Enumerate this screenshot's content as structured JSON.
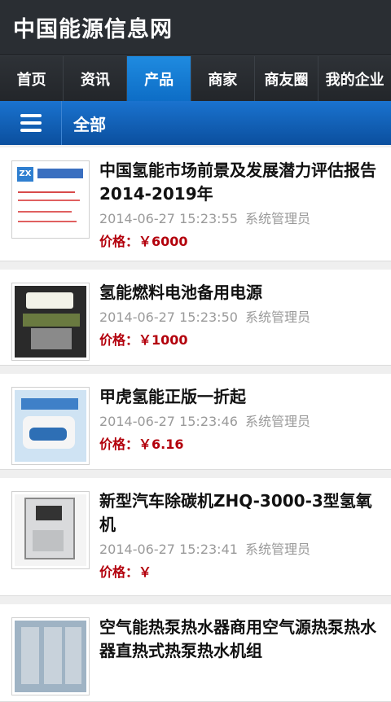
{
  "header": {
    "title": "中国能源信息网"
  },
  "nav": {
    "tabs": [
      "首页",
      "资讯",
      "产品",
      "商家",
      "商友圈",
      "我的企业"
    ],
    "active": 2
  },
  "subbar": {
    "title": "全部",
    "menu_icon": "hamburger-menu-icon"
  },
  "colors": {
    "accent": "#1577d6",
    "price": "#b3000c",
    "header_bg": "#2a2e33"
  },
  "products": [
    {
      "title": "中国氢能市场前景及发展潜力评估报告2014-2019年",
      "date": "2014-06-27 15:23:55",
      "author": "系统管理员",
      "price": "价格：￥6000"
    },
    {
      "title": "氢能燃料电池备用电源",
      "date": "2014-06-27 15:23:50",
      "author": "系统管理员",
      "price": "价格：￥1000"
    },
    {
      "title": "甲虎氢能正版一折起",
      "date": "2014-06-27 15:23:46",
      "author": "系统管理员",
      "price": "价格：￥6.16"
    },
    {
      "title": "新型汽车除碳机ZHQ-3000-3型氢氧机",
      "date": "2014-06-27 15:23:41",
      "author": "系统管理员",
      "price": "价格：￥"
    },
    {
      "title": "空气能热泵热水器商用空气源热泵热水器直热式热泵热水机组",
      "date": "",
      "author": "",
      "price": ""
    }
  ]
}
